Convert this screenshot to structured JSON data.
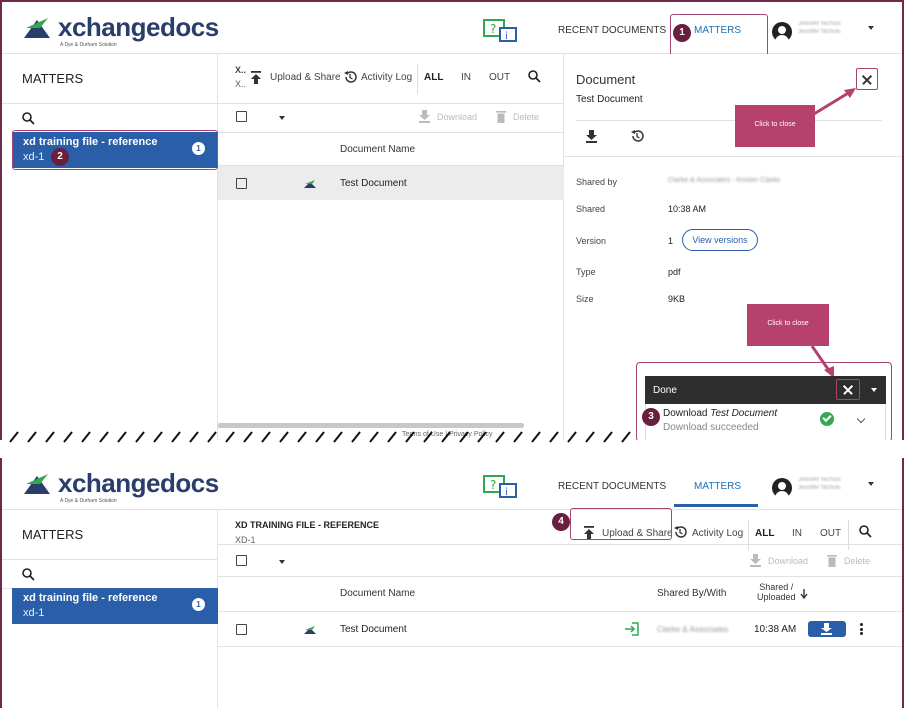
{
  "brand": {
    "name_x": "x",
    "name_rest": "changedocs",
    "tagline": "A Dye & Durham Solution"
  },
  "nav": {
    "recent": "RECENT DOCUMENTS",
    "matters": "MATTERS"
  },
  "user": {
    "line1": "Jennifer Nichols",
    "line2": "Jennifer Nichols"
  },
  "left": {
    "title": "MATTERS",
    "item": {
      "title": "xd training file - reference",
      "sub": "xd-1",
      "count": "1"
    }
  },
  "toolbar1": {
    "matter_short1": "X..",
    "matter_short2": "X..",
    "upload": "Upload & Share",
    "activity": "Activity Log",
    "all": "ALL",
    "in": "IN",
    "out": "OUT"
  },
  "toolbar2": {
    "matter_title": "XD TRAINING FILE - REFERENCE",
    "matter_sub": "XD-1",
    "upload": "Upload & Share",
    "activity": "Activity Log",
    "all": "ALL",
    "in": "IN",
    "out": "OUT"
  },
  "actions": {
    "download": "Download",
    "delete": "Delete"
  },
  "columns": {
    "name": "Document Name",
    "shared_by": "Shared By/With",
    "shared_uploaded_1": "Shared /",
    "shared_uploaded_2": "Uploaded"
  },
  "doc": {
    "name": "Test Document",
    "shared_by": "Clarke & Associates",
    "time": "10:38 AM"
  },
  "details": {
    "title": "Document",
    "subtitle": "Test Document",
    "rows": {
      "shared_by_k": "Shared by",
      "shared_by_v": "Clarke & Associates - Kristen Clarke",
      "shared_k": "Shared",
      "shared_v": "10:38 AM",
      "version_k": "Version",
      "version_v": "1",
      "type_k": "Type",
      "type_v": "pdf",
      "size_k": "Size",
      "size_v": "9KB"
    },
    "view_versions": "View versions"
  },
  "tooltips": {
    "close1": "Click to close",
    "close2": "Click to close"
  },
  "toast": {
    "done": "Done",
    "line1_prefix": "Download ",
    "line1_doc": "Test Document",
    "line2": "Download succeeded"
  },
  "footer": {
    "terms": "Terms of Use",
    "sep": "|",
    "privacy": "Privacy Policy"
  },
  "steps": {
    "s1": "1",
    "s2": "2",
    "s3": "3",
    "s4": "4"
  },
  "colors": {
    "brand_blue": "#2a5ea8",
    "callout": "#b6416d",
    "step_badge": "#6b1f3e",
    "success": "#35a853"
  }
}
